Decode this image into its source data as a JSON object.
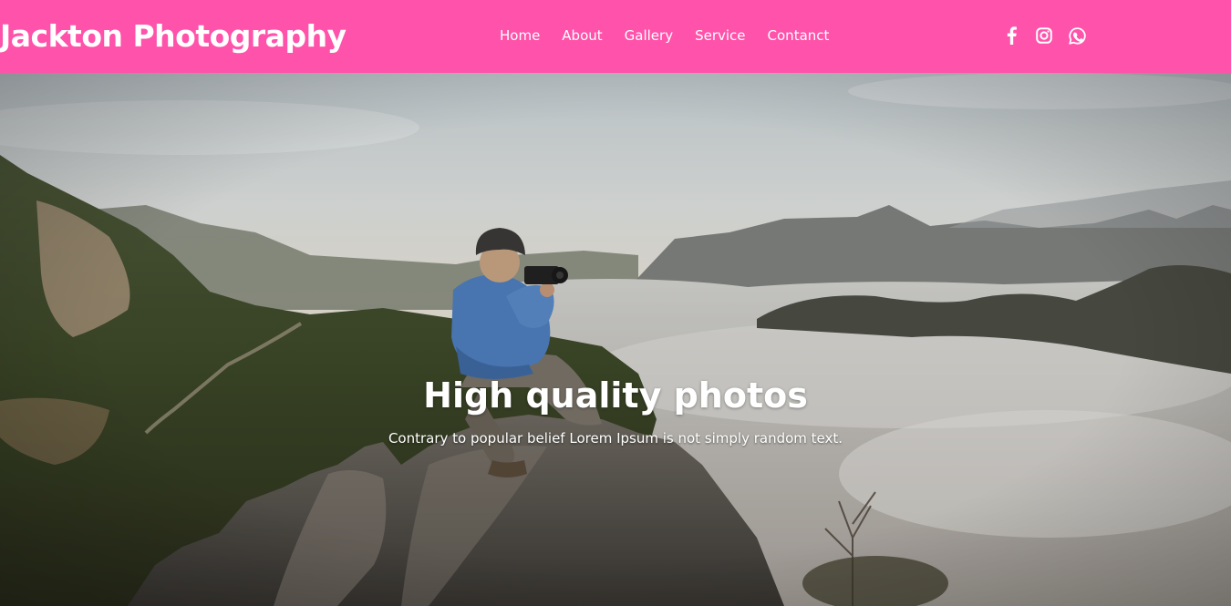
{
  "brand": {
    "name": "Jackton Photography"
  },
  "nav": {
    "items": [
      {
        "label": "Home"
      },
      {
        "label": "About"
      },
      {
        "label": "Gallery"
      },
      {
        "label": "Service"
      },
      {
        "label": "Contanct"
      }
    ]
  },
  "social": {
    "icons": [
      "facebook-icon",
      "instagram-icon",
      "whatsapp-icon"
    ]
  },
  "hero": {
    "title": "High quality photos",
    "subtitle": "Contrary to popular belief Lorem Ipsum is not simply random text.",
    "image": "photographer-on-mountain-peak"
  },
  "colors": {
    "navbar": "#ff52aa",
    "text": "#ffffff"
  }
}
